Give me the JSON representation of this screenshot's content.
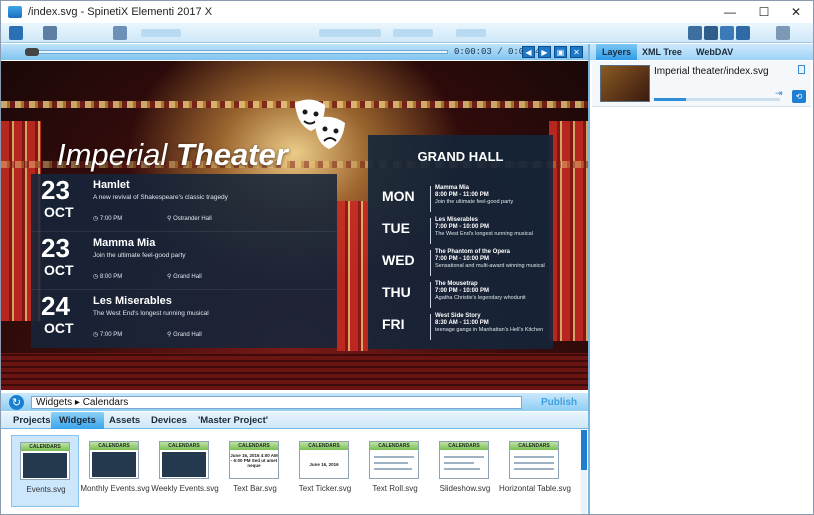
{
  "window": {
    "title": "/index.svg - SpinetiX Elementi 2017 X"
  },
  "window_controls": {
    "minimize": "—",
    "maximize": "☐",
    "close": "✕"
  },
  "player": {
    "timecode": "0:00:03 / 0:01:40"
  },
  "stage": {
    "title_light": "Imperial ",
    "title_bold": "Theater",
    "events": [
      {
        "day": "23",
        "month": "OCT",
        "name": "Hamlet",
        "description": "A new revival of Shakespeare's classic tragedy",
        "time": "7:00 PM",
        "venue": "Ostrander Hall"
      },
      {
        "day": "23",
        "month": "OCT",
        "name": "Mamma Mia",
        "description": "Join the ultimate feel-good party",
        "time": "8:00 PM",
        "venue": "Grand Hall"
      },
      {
        "day": "24",
        "month": "OCT",
        "name": "Les Miserables",
        "description": "The West End's longest running musical",
        "time": "7:00 PM",
        "venue": "Grand Hall"
      }
    ],
    "hall": {
      "title": "GRAND HALL",
      "schedule": [
        {
          "weekday": "MON",
          "show": "Mamma Mia",
          "time": "8:00 PM - 11:00 PM",
          "desc": "Join the ultimate feel-good party"
        },
        {
          "weekday": "TUE",
          "show": "Les Miserables",
          "time": "7:00 PM - 10:00 PM",
          "desc": "The West End's longest running musical"
        },
        {
          "weekday": "WED",
          "show": "The Phantom of the Opera",
          "time": "7:00 PM - 10:00 PM",
          "desc": "Sensational and multi-award winning musical"
        },
        {
          "weekday": "THU",
          "show": "The Mousetrap",
          "time": "7:00 PM - 10:00 PM",
          "desc": "Agatha Christie's legendary whodunit"
        },
        {
          "weekday": "FRI",
          "show": "West Side Story",
          "time": "8:30 AM - 11:00 PM",
          "desc": "teenage gangs in Manhattan's Hell's Kitchen"
        }
      ]
    }
  },
  "pathbar": {
    "path": "Widgets  ▸  Calendars",
    "publish": "Publish"
  },
  "bottom_tabs": [
    "Projects",
    "Widgets",
    "Assets",
    "Devices",
    "'Master Project'"
  ],
  "gallery": {
    "thumb_header": "CALENDARS",
    "items": [
      {
        "label": "Events.svg",
        "style": "dark"
      },
      {
        "label": "Monthly Events.svg",
        "style": "dark"
      },
      {
        "label": "Weekly Events.svg",
        "style": "dark"
      },
      {
        "label": "Text Bar.svg",
        "style": "textbar",
        "text": "June 16, 2016 4:00 AM - 6:00 PM Sed ut amet neque"
      },
      {
        "label": "Text Ticker.svg",
        "style": "ticker",
        "text": "June 16, 2016"
      },
      {
        "label": "Text Roll.svg",
        "style": "lines"
      },
      {
        "label": "Slideshow.svg",
        "style": "lines"
      },
      {
        "label": "Horizontal Table.svg",
        "style": "lines"
      }
    ]
  },
  "right_panel": {
    "tabs": [
      "Layers",
      "XML Tree",
      "WebDAV"
    ],
    "layer": {
      "name": "Imperial theater/index.svg",
      "progress": 0.25
    }
  },
  "colors": {
    "accent": "#1e80d2",
    "panel": "#14263a"
  }
}
